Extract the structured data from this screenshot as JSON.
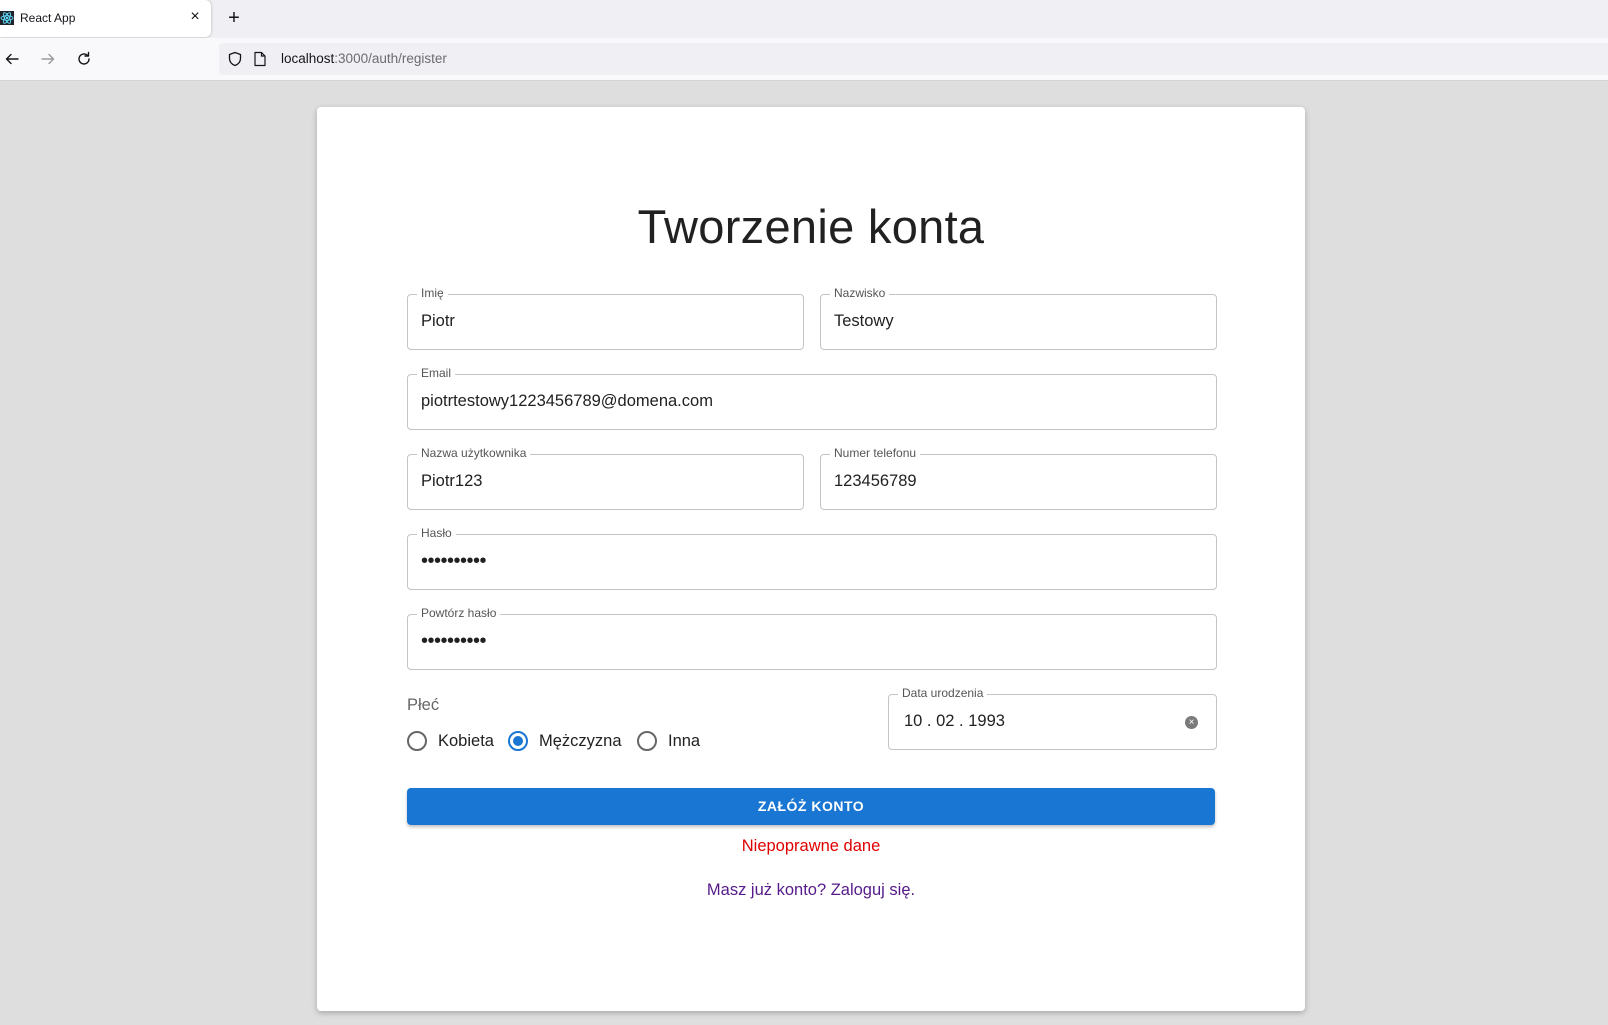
{
  "browser": {
    "tab_title": "React App",
    "close_symbol": "×",
    "newtab_symbol": "+",
    "url_host": "localhost",
    "url_rest": ":3000/auth/register"
  },
  "form": {
    "title": "Tworzenie konta",
    "first_name": {
      "label": "Imię",
      "value": "Piotr"
    },
    "last_name": {
      "label": "Nazwisko",
      "value": "Testowy"
    },
    "email": {
      "label": "Email",
      "value": "piotrtestowy1223456789@domena.com"
    },
    "username": {
      "label": "Nazwa użytkownika",
      "value": "Piotr123"
    },
    "phone": {
      "label": "Numer telefonu",
      "value": "123456789"
    },
    "password": {
      "label": "Hasło",
      "masked": "••••••••••"
    },
    "password_repeat": {
      "label": "Powtórz hasło",
      "masked": "••••••••••"
    },
    "gender": {
      "label": "Płeć",
      "options": [
        "Kobieta",
        "Mężczyzna",
        "Inna"
      ],
      "selected": "Mężczyzna"
    },
    "birth_date": {
      "label": "Data urodzenia",
      "value": "10 . 02 . 1993"
    },
    "submit_label": "ZAŁÓŻ KONTO",
    "error_text": "Niepoprawne dane",
    "login_link": "Masz już konto? Zaloguj się."
  },
  "colors": {
    "primary": "#1976d2",
    "error": "#e00000",
    "link_visited": "#551a8b"
  }
}
